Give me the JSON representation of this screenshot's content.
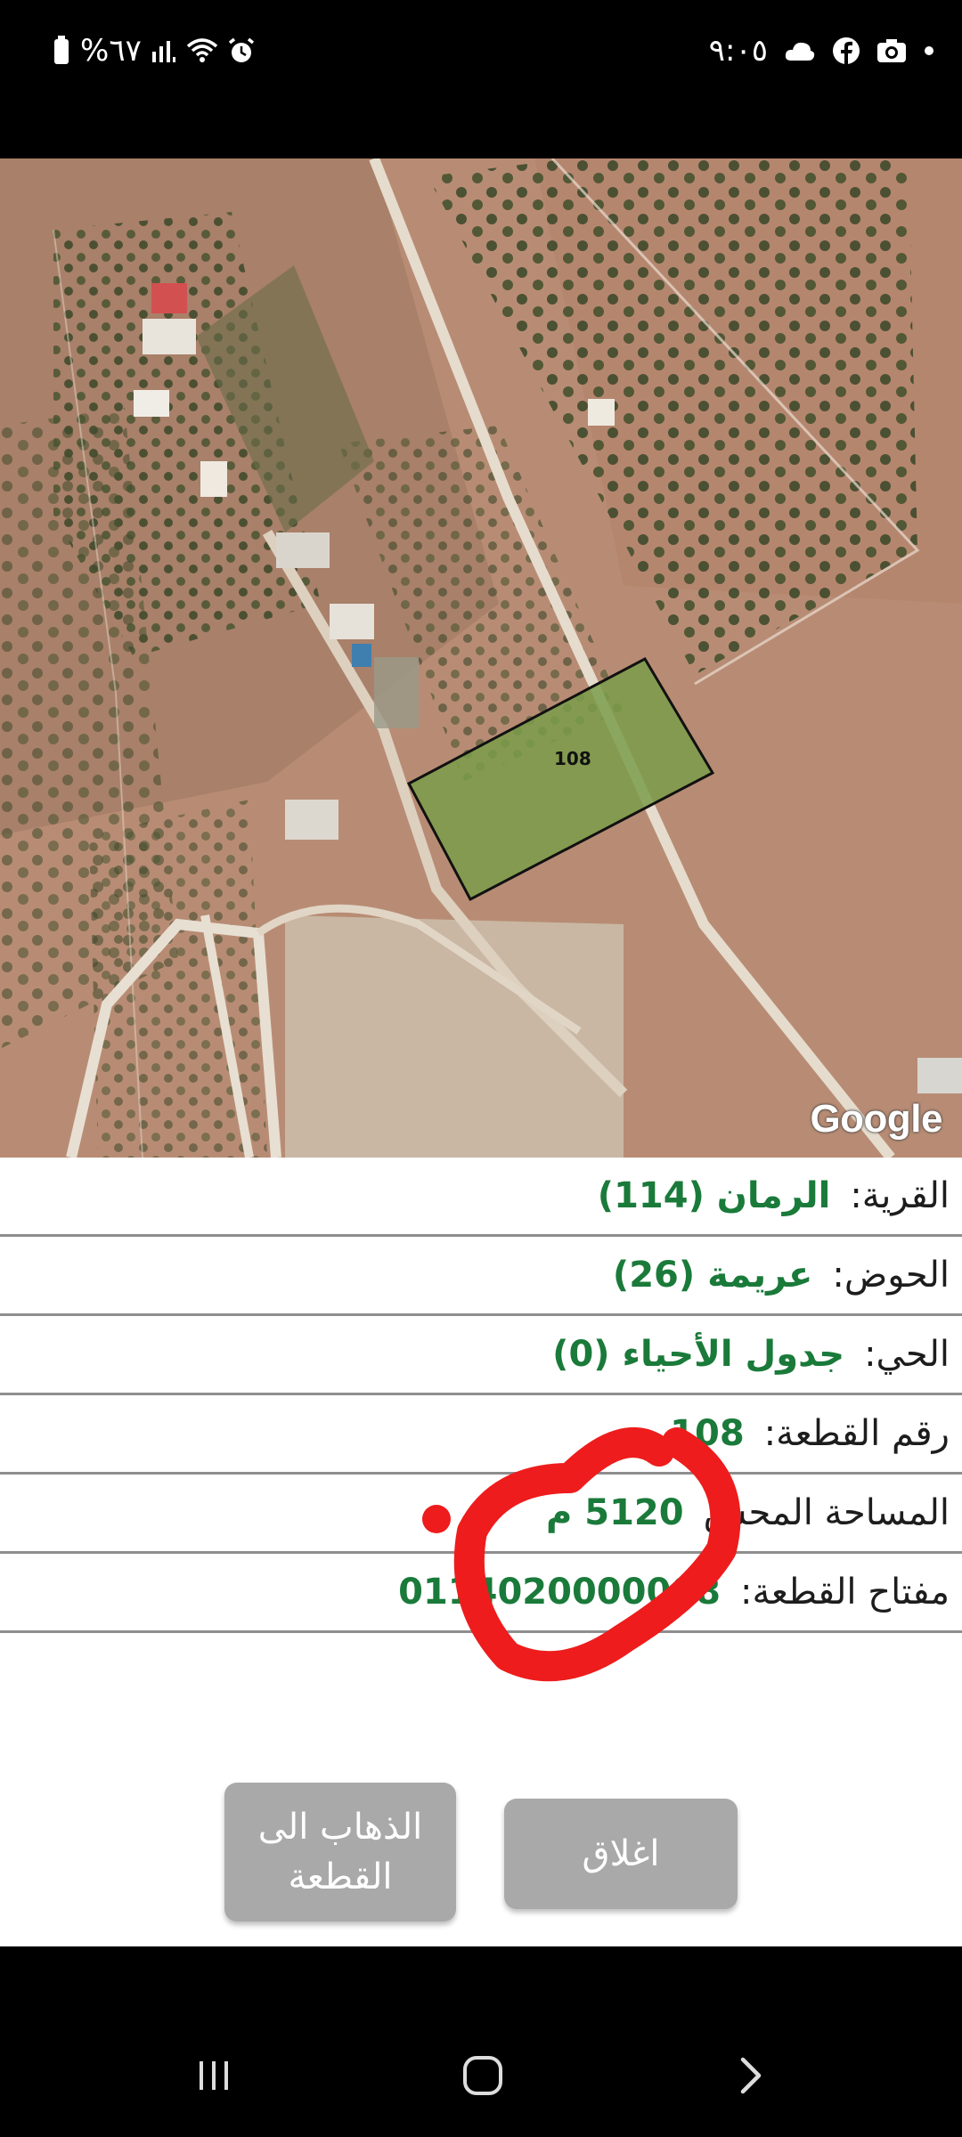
{
  "status_bar": {
    "time": "٩:٠٥",
    "battery_text": "%٦٧",
    "icons_right": [
      "cloud-icon",
      "facebook-icon",
      "camera-icon",
      "dot-icon"
    ],
    "icons_left": [
      "battery-icon",
      "signal-icon",
      "wifi-icon",
      "alarm-icon"
    ]
  },
  "map": {
    "parcel_label": "108",
    "attribution": "Google",
    "parcel_fill": "#7a9c4a",
    "parcel_stroke": "#111111"
  },
  "parcel_info": {
    "rows": [
      {
        "label": "القرية:",
        "value": "الرمان (114)"
      },
      {
        "label": "الحوض:",
        "value": "عريمة (26)"
      },
      {
        "label": "الحي:",
        "value": "جدول الأحياء (0)"
      },
      {
        "label": "رقم القطعة:",
        "value": "108"
      },
      {
        "label": "المساحة المحس",
        "value": "5120 م"
      },
      {
        "label": "مفتاح القطعة:",
        "value": "0114020000008"
      }
    ]
  },
  "actions": {
    "go_to_parcel": "الذهاب الى القطعة",
    "close": "اغلاق"
  },
  "colors": {
    "value_green": "#1a7a3a",
    "button_gray": "#a9a9a9",
    "annotation_red": "#ee1c1c"
  }
}
